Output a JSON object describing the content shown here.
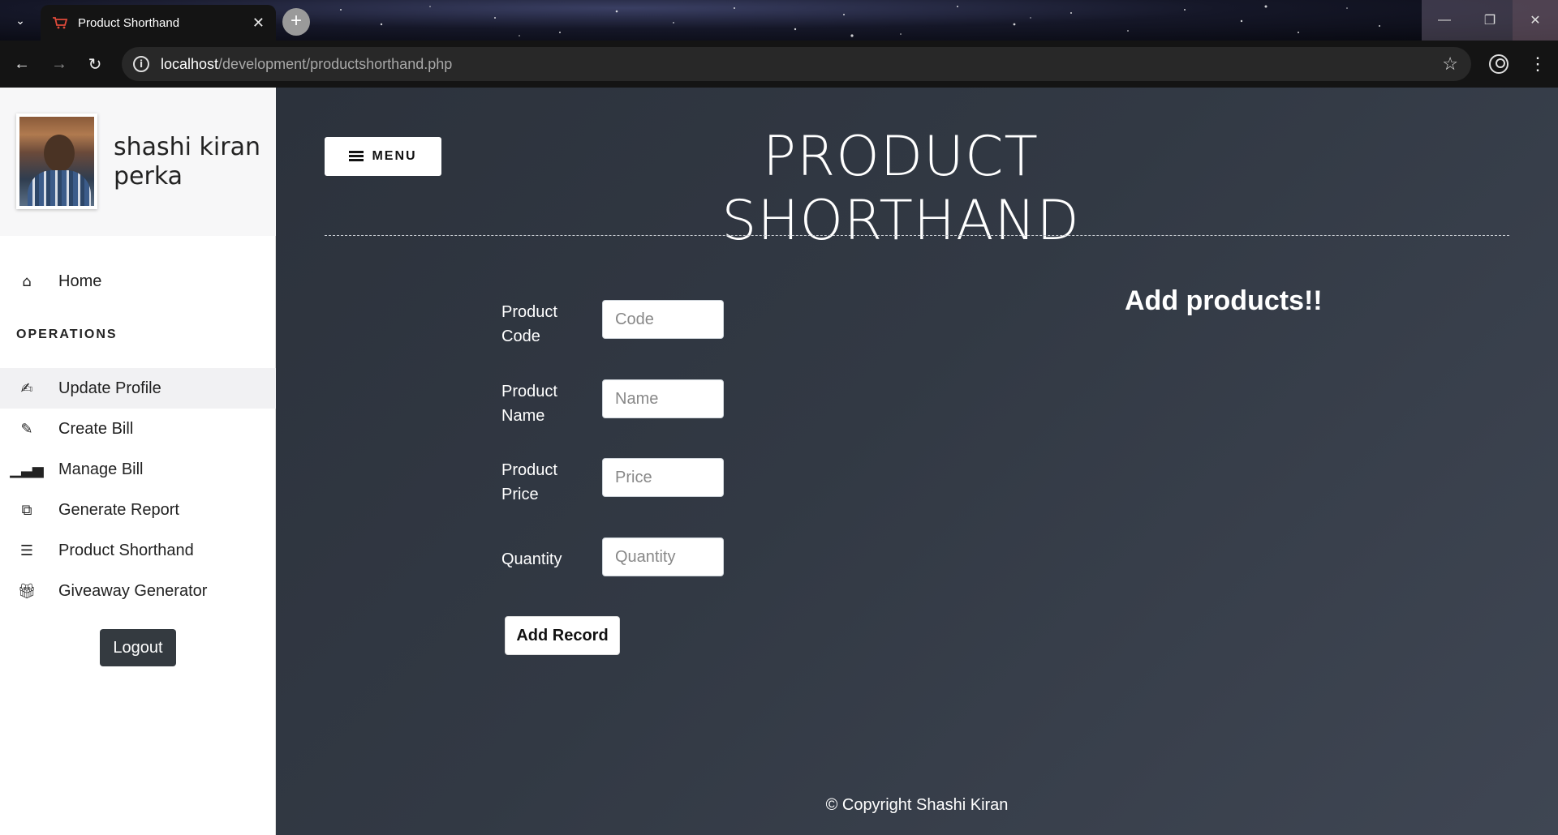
{
  "browser": {
    "tab_title": "Product Shorthand",
    "tab_close": "✕",
    "new_tab": "+",
    "url_host": "localhost",
    "url_path": "/development/productshorthand.php"
  },
  "sidebar": {
    "user_name": "shashi kiran perka",
    "home_label": "Home",
    "section_label": "OPERATIONS",
    "items": [
      {
        "label": "Update Profile",
        "icon": "pen-signature-icon"
      },
      {
        "label": "Create Bill",
        "icon": "edit-icon"
      },
      {
        "label": "Manage Bill",
        "icon": "bar-chart-icon"
      },
      {
        "label": "Generate Report",
        "icon": "clone-icon"
      },
      {
        "label": "Product Shorthand",
        "icon": "list-icon"
      },
      {
        "label": "Giveaway Generator",
        "icon": "gift-icon"
      }
    ],
    "logout_label": "Logout"
  },
  "main": {
    "menu_label": "MENU",
    "title": "PRODUCT SHORTHAND",
    "form": {
      "code_label": "Product Code",
      "code_placeholder": "Code",
      "name_label": "Product Name",
      "name_placeholder": "Name",
      "price_label": "Product Price",
      "price_placeholder": "Price",
      "quantity_label": "Quantity",
      "quantity_placeholder": "Quantity",
      "submit_label": "Add Record"
    },
    "side_heading": "Add products!!",
    "footer": "© Copyright Shashi Kiran"
  }
}
